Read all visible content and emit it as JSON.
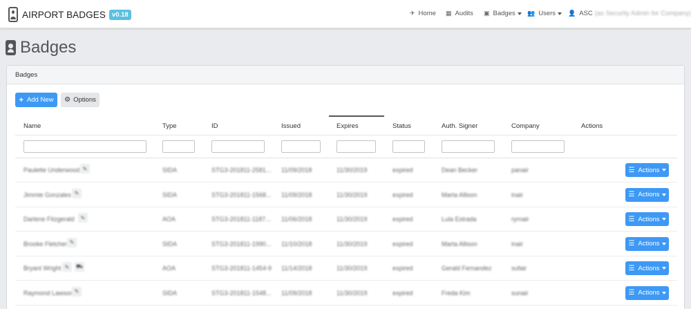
{
  "app": {
    "brand": "AIRPORT BADGES",
    "version": "v0.18"
  },
  "nav": {
    "home": "Home",
    "audits": "Audits",
    "badges": "Badges",
    "users": "Users",
    "user_name": "ASC",
    "user_role": "(as Security Admin for Company)"
  },
  "page": {
    "title": "Badges"
  },
  "card": {
    "header": "Badges",
    "add_new": "Add New",
    "options": "Options"
  },
  "table": {
    "columns": [
      "Name",
      "Type",
      "ID",
      "Issued",
      "Expires",
      "Status",
      "Auth. Signer",
      "Company",
      "Actions"
    ],
    "sorted_column": "Expires",
    "action_label": "Actions",
    "rows": [
      {
        "name": "Paulette Underwood",
        "type": "SIDA",
        "id": "STG3-201811-2581...",
        "issued": "11/09/2018",
        "expires": "11/30/2019",
        "status": "expired",
        "signer": "Dean Becker",
        "company": "panair",
        "extra_icon": false
      },
      {
        "name": "Jimmie Gonzales",
        "type": "SIDA",
        "id": "STG3-201811-1568...",
        "issued": "11/09/2018",
        "expires": "11/30/2019",
        "status": "expired",
        "signer": "Marta Allison",
        "company": "inair",
        "extra_icon": false
      },
      {
        "name": "Darlene Fitzgerald",
        "type": "AOA",
        "id": "STG3-201811-1187...",
        "issued": "11/06/2018",
        "expires": "11/30/2019",
        "status": "expired",
        "signer": "Lula Estrada",
        "company": "ryrnair",
        "extra_icon": false
      },
      {
        "name": "Brooke Fletcher",
        "type": "SIDA",
        "id": "STG3-201811-1990...",
        "issued": "11/10/2018",
        "expires": "11/30/2019",
        "status": "expired",
        "signer": "Marta Allison",
        "company": "inair",
        "extra_icon": false
      },
      {
        "name": "Bryant Wright",
        "type": "AOA",
        "id": "STG3-201811-1454-9",
        "issued": "11/14/2018",
        "expires": "11/30/2019",
        "status": "expired",
        "signer": "Gerald Fernandez",
        "company": "sufair",
        "extra_icon": true
      },
      {
        "name": "Raymond Lawson",
        "type": "SIDA",
        "id": "STG3-201811-1548...",
        "issued": "11/09/2018",
        "expires": "11/30/2019",
        "status": "expired",
        "signer": "Freda Kim",
        "company": "sunair",
        "extra_icon": false
      }
    ]
  }
}
